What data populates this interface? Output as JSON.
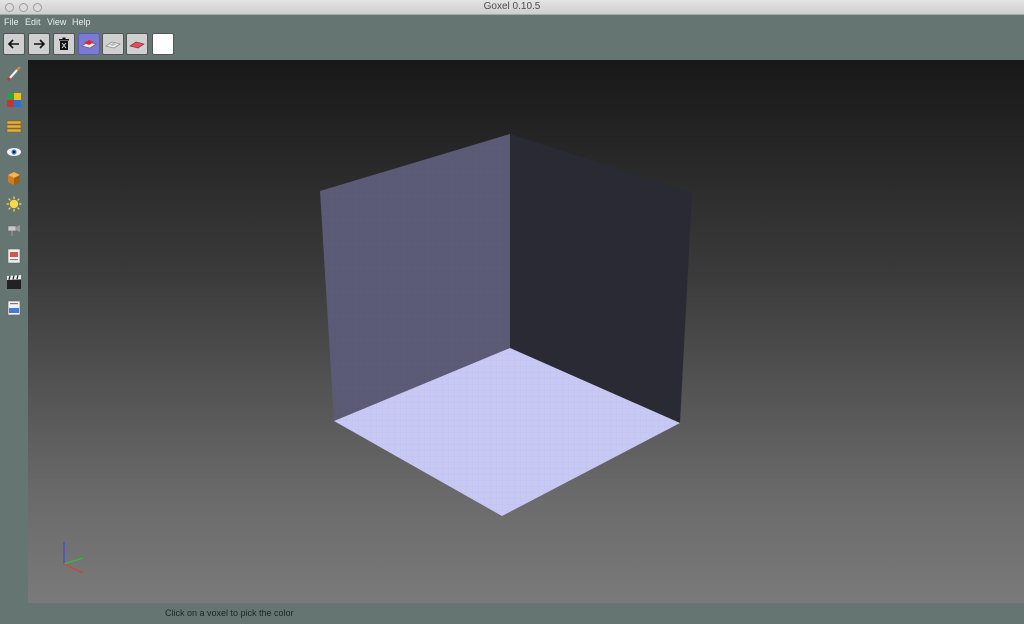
{
  "window": {
    "title": "Goxel 0.10.5"
  },
  "menu": {
    "items": [
      "File",
      "Edit",
      "View",
      "Help"
    ]
  },
  "toolbar": {
    "buttons": [
      "undo-icon",
      "redo-icon",
      "clear-icon",
      "add-mode-icon",
      "subtract-mode-icon",
      "paint-mode-icon"
    ],
    "active_mode": "add",
    "color": "#ffffff"
  },
  "sidebar": {
    "tools": [
      "brush-icon",
      "palette-icon",
      "layers-icon",
      "view-icon",
      "material-icon",
      "light-icon",
      "cameras-icon",
      "image-icon",
      "render-icon",
      "export-icon"
    ]
  },
  "viewport": {
    "wall_left_color": "#5b5b77",
    "wall_right_color": "#2a2a35",
    "floor_color": "#c8c8f5"
  },
  "status": {
    "text": "Click on a voxel to pick the color"
  }
}
